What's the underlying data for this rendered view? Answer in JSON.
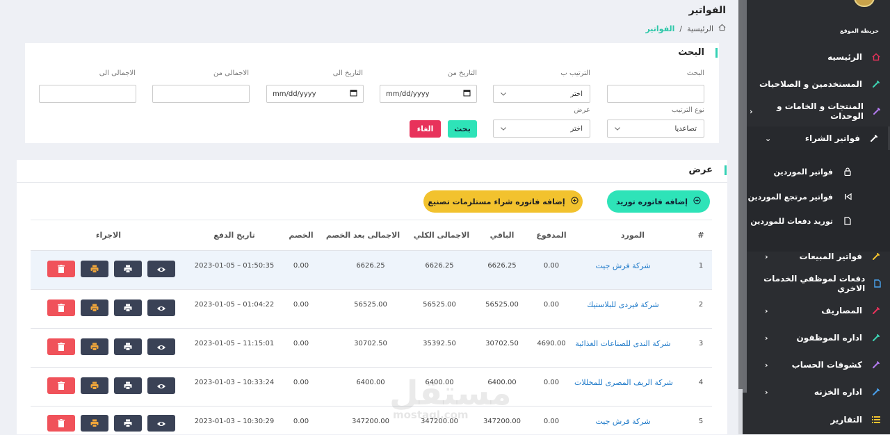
{
  "header": {
    "title": "الفواتير"
  },
  "breadcrumb": {
    "home": "الرئيسية",
    "sep": "/",
    "current": "الفواتير"
  },
  "search": {
    "title": "البحث",
    "search_label": "البحث",
    "sort_by_label": "الترتيب ب",
    "sort_by_value": "اختر",
    "date_from_label": "التاريخ من",
    "date_from_placeholder": "mm/dd/yyyy",
    "date_to_label": "التاريخ الى",
    "date_to_placeholder": "mm/dd/yyyy",
    "total_from_label": "الاجمالى من",
    "total_to_label": "الاجمالى الى",
    "sort_type_label": "نوع الترتيب",
    "sort_type_value": "تصاعديا",
    "display_label": "عرض",
    "display_value": "اختر",
    "search_button": "بحث",
    "cancel_button": "الغاء"
  },
  "list": {
    "title": "عرض",
    "add_supply_button": "إضافه فاتوره توريد",
    "add_manufacturing_button": "إضافه فاتوره شراء مستلزمات تصنيع",
    "columns": [
      "#",
      "المورد",
      "المدفوع",
      "الباقي",
      "الاجمالى الكلي",
      "الاجمالى بعد الخصم",
      "الخصم",
      "تاريخ الدفع",
      "الاجراء"
    ],
    "rows": [
      {
        "n": "1",
        "supplier": "شركة فرش جيت",
        "paid": "0.00",
        "remaining": "6626.25",
        "total": "6626.25",
        "after_discount": "6626.25",
        "discount": "0.00",
        "date": "2023-01-05 – 01:50:35"
      },
      {
        "n": "2",
        "supplier": "شركة فيردى للبلاستيك",
        "paid": "0.00",
        "remaining": "56525.00",
        "total": "56525.00",
        "after_discount": "56525.00",
        "discount": "0.00",
        "date": "2023-01-05 – 01:04:22"
      },
      {
        "n": "3",
        "supplier": "شركة الندى للصناعات الغذائية",
        "paid": "4690.00",
        "remaining": "30702.50",
        "total": "35392.50",
        "after_discount": "30702.50",
        "discount": "0.00",
        "date": "2023-01-05 – 11:15:01"
      },
      {
        "n": "4",
        "supplier": "شركة الريف المصرى للمخللات",
        "paid": "0.00",
        "remaining": "6400.00",
        "total": "6400.00",
        "after_discount": "6400.00",
        "discount": "0.00",
        "date": "2023-01-03 – 10:33:24"
      },
      {
        "n": "5",
        "supplier": "شركة فرش جيت",
        "paid": "0.00",
        "remaining": "347200.00",
        "total": "347200.00",
        "after_discount": "347200.00",
        "discount": "0.00",
        "date": "2023-01-03 – 10:30:29"
      }
    ]
  },
  "sidebar": {
    "sitemap": "خريطه الموقع",
    "items": [
      {
        "label": "الرئيسيه",
        "icon": "home-icon"
      },
      {
        "label": "المستخدمين و الصلاحيات",
        "icon": "pen-icon"
      },
      {
        "label": "المنتجات و الخامات و الوحدات",
        "icon": "pen-icon"
      },
      {
        "label": "فواتير الشراء",
        "icon": "clip-icon"
      },
      {
        "label": "فواتير المبيعات",
        "icon": "pen-icon"
      },
      {
        "label": "دفعات لموظفي الخدمات الاخري",
        "icon": "file-icon"
      },
      {
        "label": "المصاريف",
        "icon": "pen-icon"
      },
      {
        "label": "اداره الموظفون",
        "icon": "pen-icon"
      },
      {
        "label": "كشوفات الحساب",
        "icon": "pen-icon"
      },
      {
        "label": "اداره الخزنه",
        "icon": "pen-icon"
      },
      {
        "label": "التقارير",
        "icon": "list-icon"
      }
    ],
    "subitems": [
      {
        "label": "فواتير الموردين",
        "icon": "lock-icon"
      },
      {
        "label": "فواتير مرتجع الموردين",
        "icon": "skip-back-icon"
      },
      {
        "label": "توريد دفعات للموردين",
        "icon": "file-icon"
      }
    ]
  },
  "watermark": {
    "main": "مستقل",
    "sub": "mostaql.com"
  },
  "colors": {
    "teal": "#34d1b4",
    "red": "#e8325b",
    "yellow": "#f2c22e",
    "sidebar": "#2b2d31",
    "link": "#1f7ac9"
  }
}
